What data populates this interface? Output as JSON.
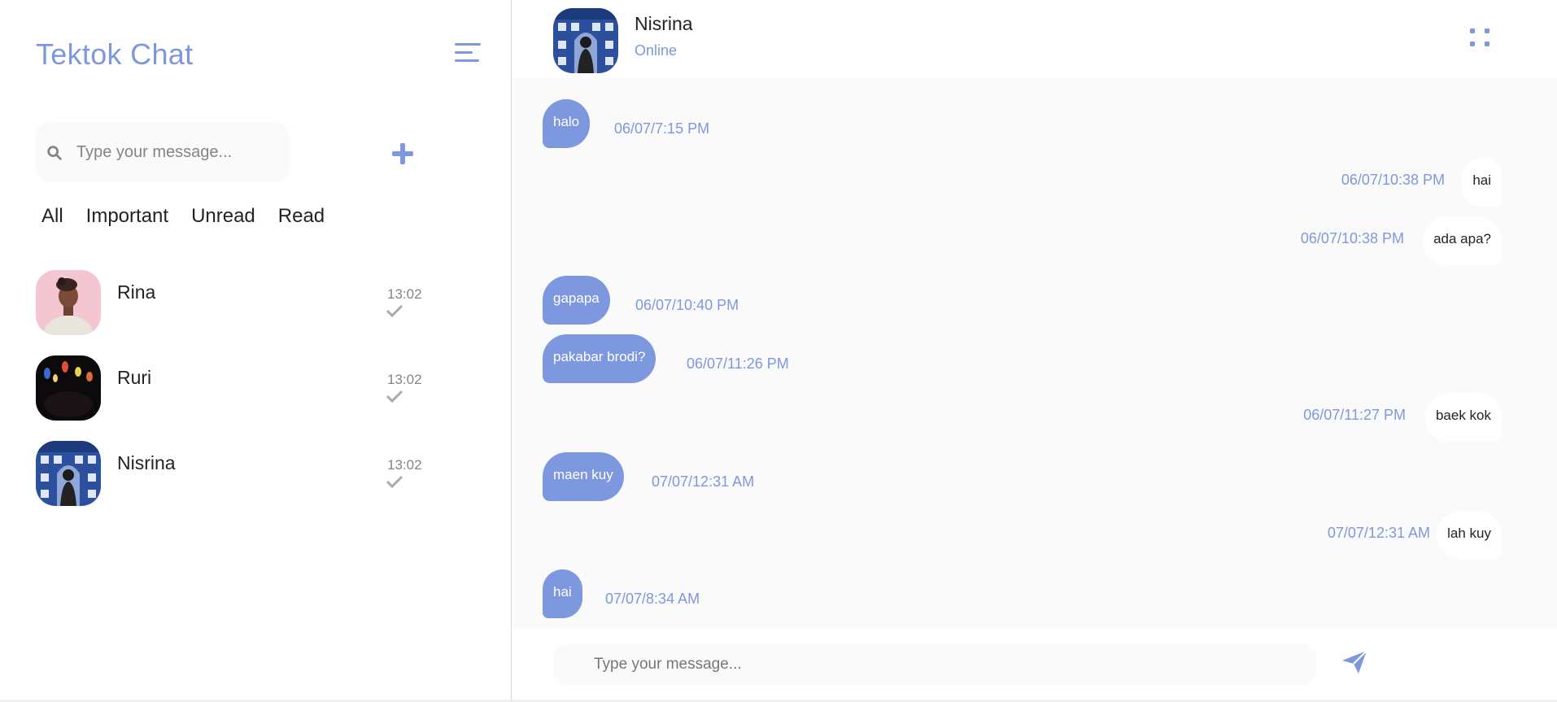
{
  "app": {
    "title": "Tektok Chat"
  },
  "colors": {
    "accent": "#7e98df",
    "text": "#232323",
    "muted": "#848484",
    "panel": "#fafafa"
  },
  "sidebar": {
    "menu_icon": "hamburger-menu-icon",
    "search": {
      "placeholder": "Type your message...",
      "icon": "search-icon"
    },
    "add_icon": "plus-icon",
    "filters": [
      "All",
      "Important",
      "Unread",
      "Read"
    ],
    "contacts": [
      {
        "name": "Rina",
        "time": "13:02",
        "status_icon": "check-icon"
      },
      {
        "name": "Ruri",
        "time": "13:02",
        "status_icon": "check-icon"
      },
      {
        "name": "Nisrina",
        "time": "13:02",
        "status_icon": "check-icon"
      }
    ]
  },
  "chat": {
    "contact_name": "Nisrina",
    "contact_status": "Online",
    "options_icon": "four-dots-icon",
    "messages": [
      {
        "dir": "in",
        "text": "halo",
        "time": "06/07/7:15 PM"
      },
      {
        "dir": "out",
        "text": "hai",
        "time": "06/07/10:38 PM"
      },
      {
        "dir": "out",
        "text": "ada apa?",
        "time": "06/07/10:38 PM"
      },
      {
        "dir": "in",
        "text": "gapapa",
        "time": "06/07/10:40 PM"
      },
      {
        "dir": "in",
        "text": "pakabar brodi?",
        "time": "06/07/11:26 PM"
      },
      {
        "dir": "out",
        "text": "baek kok",
        "time": "06/07/11:27 PM"
      },
      {
        "dir": "in",
        "text": "maen kuy",
        "time": "07/07/12:31 AM"
      },
      {
        "dir": "out",
        "text": "lah kuy",
        "time": "07/07/12:31 AM"
      },
      {
        "dir": "in",
        "text": "hai",
        "time": "07/07/8:34 AM"
      }
    ],
    "composer": {
      "placeholder": "Type your message...",
      "send_icon": "send-icon"
    }
  }
}
